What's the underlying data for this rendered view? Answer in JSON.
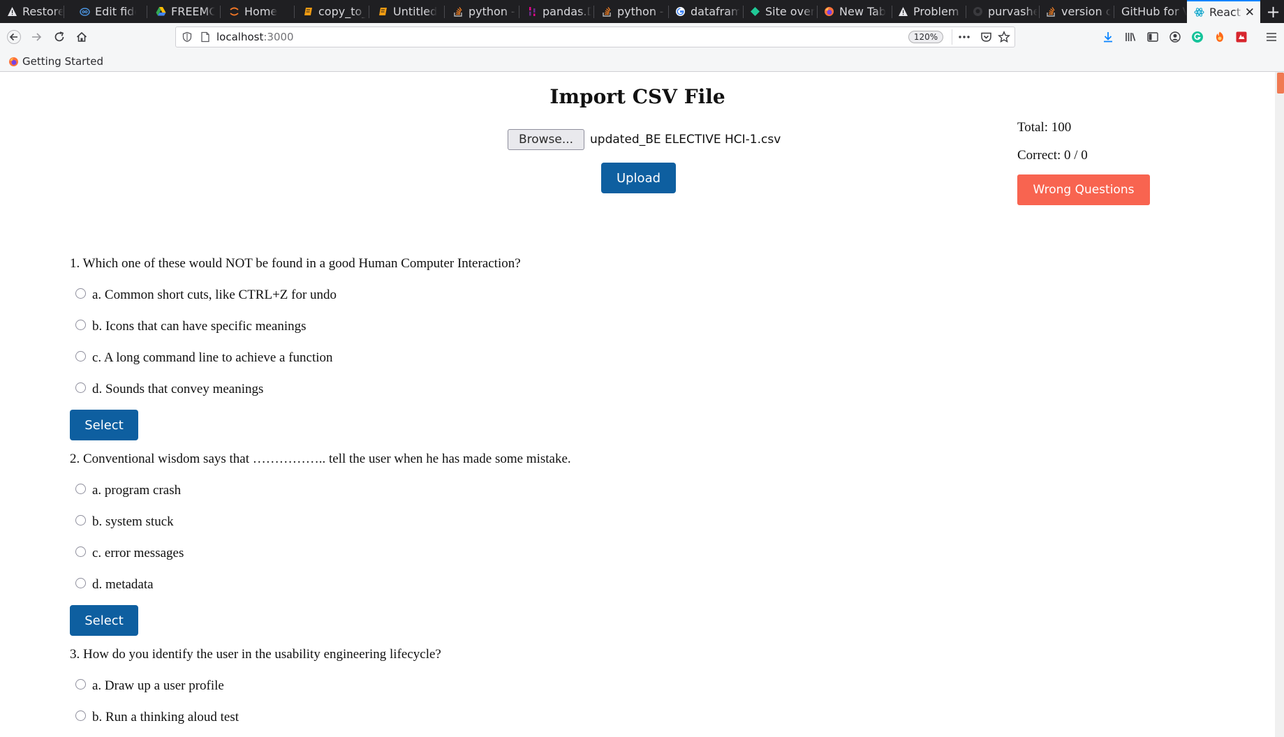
{
  "browser": {
    "tabs": [
      {
        "label": "Restore S",
        "icon": "warning-icon"
      },
      {
        "label": "Edit fiddl",
        "icon": "jsfiddle-icon"
      },
      {
        "label": "FREEMCC",
        "icon": "drive-icon"
      },
      {
        "label": "Home",
        "icon": "jupyter-icon"
      },
      {
        "label": "copy_to_",
        "icon": "notebook-icon"
      },
      {
        "label": "Untitled",
        "icon": "notebook-icon"
      },
      {
        "label": "python - I",
        "icon": "stackoverflow-icon"
      },
      {
        "label": "pandas.D",
        "icon": "pandas-icon"
      },
      {
        "label": "python - I",
        "icon": "stackoverflow-icon"
      },
      {
        "label": "datafram",
        "icon": "google-icon"
      },
      {
        "label": "Site overv",
        "icon": "site-icon"
      },
      {
        "label": "New Tab",
        "icon": "firefox-icon"
      },
      {
        "label": "Problem l",
        "icon": "warning-icon"
      },
      {
        "label": "purvashe",
        "icon": "github-icon"
      },
      {
        "label": "version co",
        "icon": "stackoverflow-icon"
      },
      {
        "label": "GitHub for V",
        "icon": "none"
      },
      {
        "label": "React",
        "icon": "react-icon",
        "active": true
      }
    ],
    "url_host": "localhost",
    "url_port": ":3000",
    "zoom": "120%",
    "bookmark": "Getting Started"
  },
  "page": {
    "title": "Import CSV File",
    "browse_label": "Browse...",
    "file_name": "updated_BE ELECTIVE HCI-1.csv",
    "upload_label": "Upload",
    "total": "Total: 100",
    "correct": "Correct: 0 / 0",
    "wrong_label": "Wrong Questions",
    "select_label": "Select",
    "questions": [
      {
        "text": "1. Which one of these would NOT be found in a good Human Computer Interaction?",
        "options": [
          "a. Common short cuts, like CTRL+Z for undo",
          "b. Icons that can have specific meanings",
          "c. A long command line to achieve a function",
          "d. Sounds that convey meanings"
        ]
      },
      {
        "text": "2. Conventional wisdom says that …………….. tell the user when he has made some mistake.",
        "options": [
          "a. program crash",
          "b. system stuck",
          "c. error messages",
          "d. metadata"
        ]
      },
      {
        "text": "3. How do you identify the user in the usability engineering lifecycle?",
        "options": [
          "a. Draw up a user profile",
          "b. Run a thinking aloud test"
        ]
      }
    ]
  },
  "colors": {
    "primary_button": "#0e5fa0",
    "wrong_button": "#f86450",
    "tab_active_accent": "#0a84ff"
  }
}
